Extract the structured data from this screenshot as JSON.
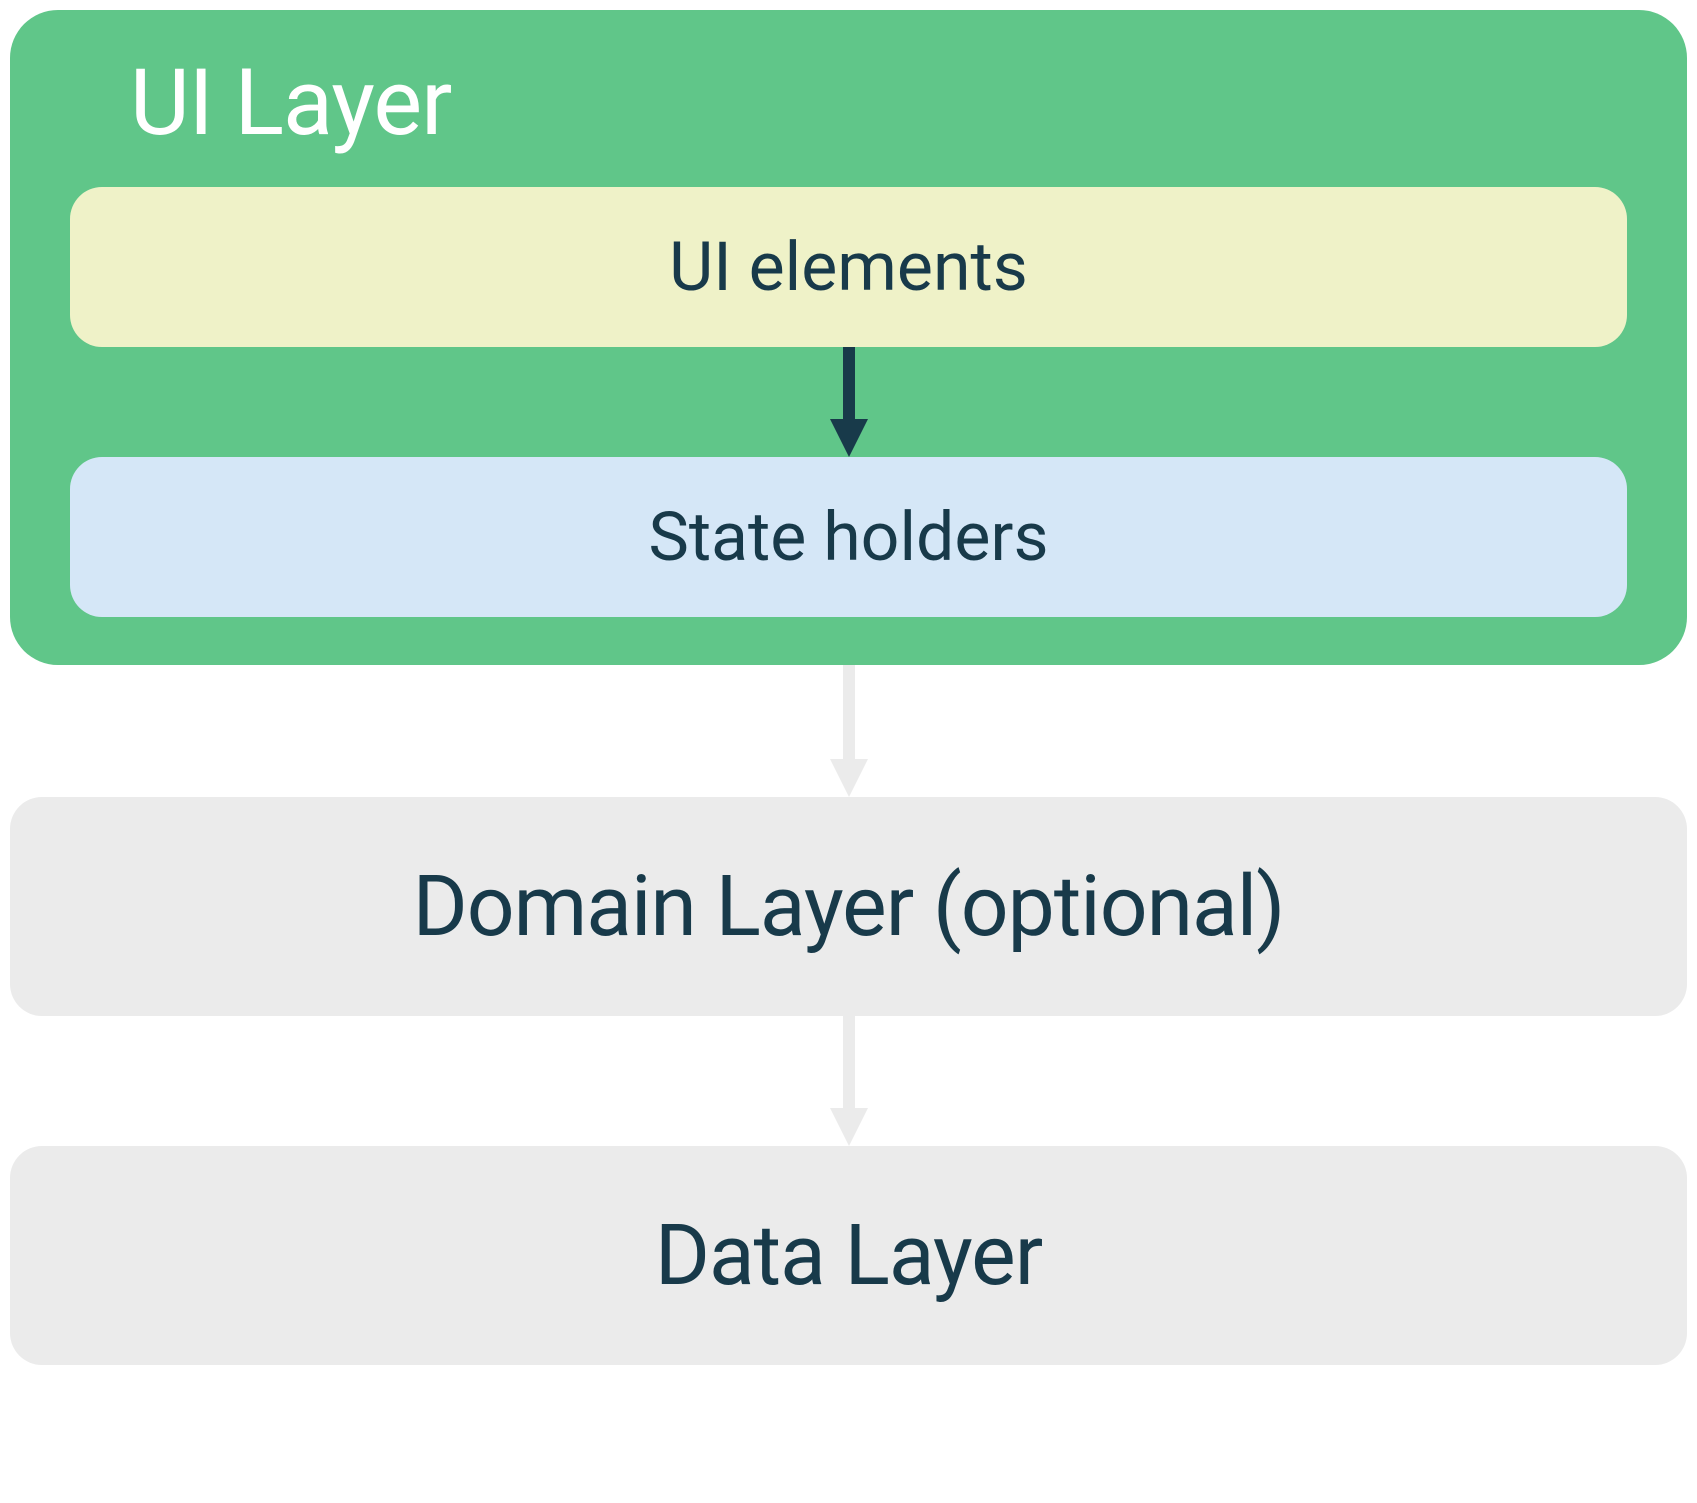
{
  "ui_layer": {
    "title": "UI Layer",
    "ui_elements_label": "UI elements",
    "state_holders_label": "State holders"
  },
  "domain_layer": {
    "label": "Domain Layer (optional)"
  },
  "data_layer": {
    "label": "Data Layer"
  },
  "colors": {
    "green": "#60c689",
    "yellow": "#eff2c8",
    "blue": "#d5e7f7",
    "gray": "#ebebeb",
    "text_dark": "#183a4a",
    "arrow_dark": "#183a4a",
    "arrow_light": "#ebebeb"
  }
}
